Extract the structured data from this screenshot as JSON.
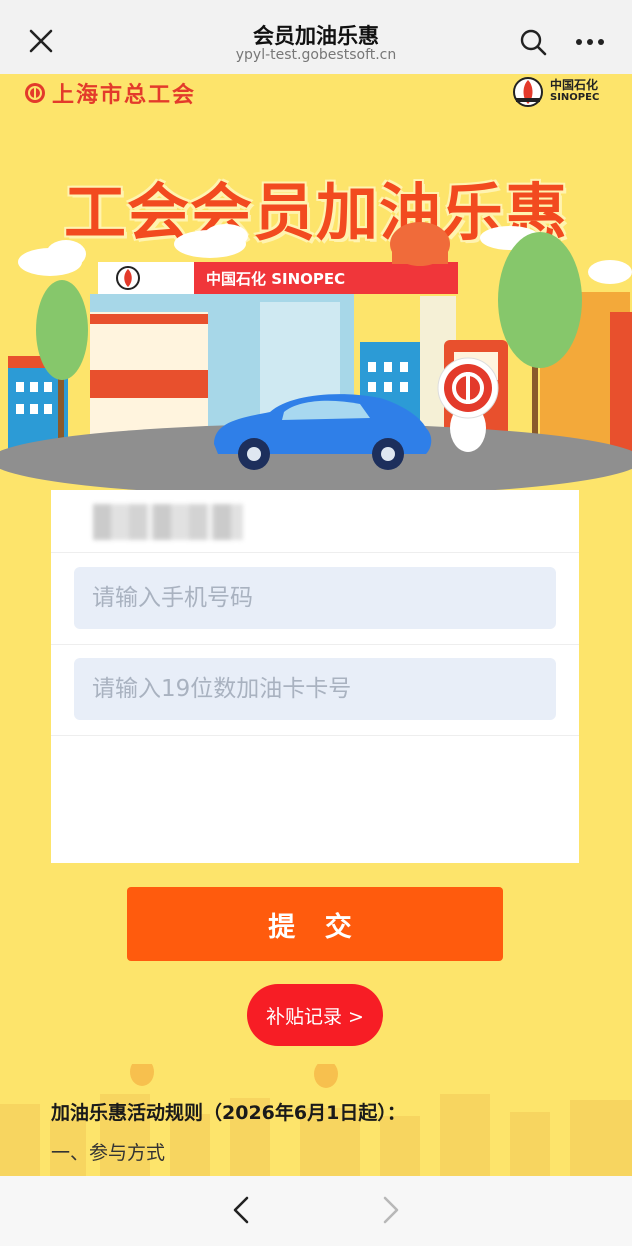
{
  "topbar": {
    "title": "会员加油乐惠",
    "url": "ypyl-test.gobestsoft.cn",
    "close_icon": "close-icon",
    "search_icon": "search-icon",
    "more_icon": "more-icon"
  },
  "header": {
    "union_name": "上海市总工会",
    "sinopec_cn": "中国石化",
    "sinopec_en": "SINOPEC",
    "headline": "工会会员加油乐惠",
    "station_sign": "中国石化 SINOPEC"
  },
  "form": {
    "phone_placeholder": "请输入手机号码",
    "card_placeholder": "请输入19位数加油卡卡号"
  },
  "actions": {
    "submit_label": "提 交",
    "records_label": "补贴记录 >"
  },
  "rules": {
    "title": "加油乐惠活动规则（2026年6月1日起）：",
    "section1": "一、参与方式"
  },
  "colors": {
    "background": "#fde46b",
    "accent_orange": "#ff5b0d",
    "accent_red": "#f71d25",
    "headline": "#f24a1f",
    "input_bg": "#e8eef8"
  }
}
